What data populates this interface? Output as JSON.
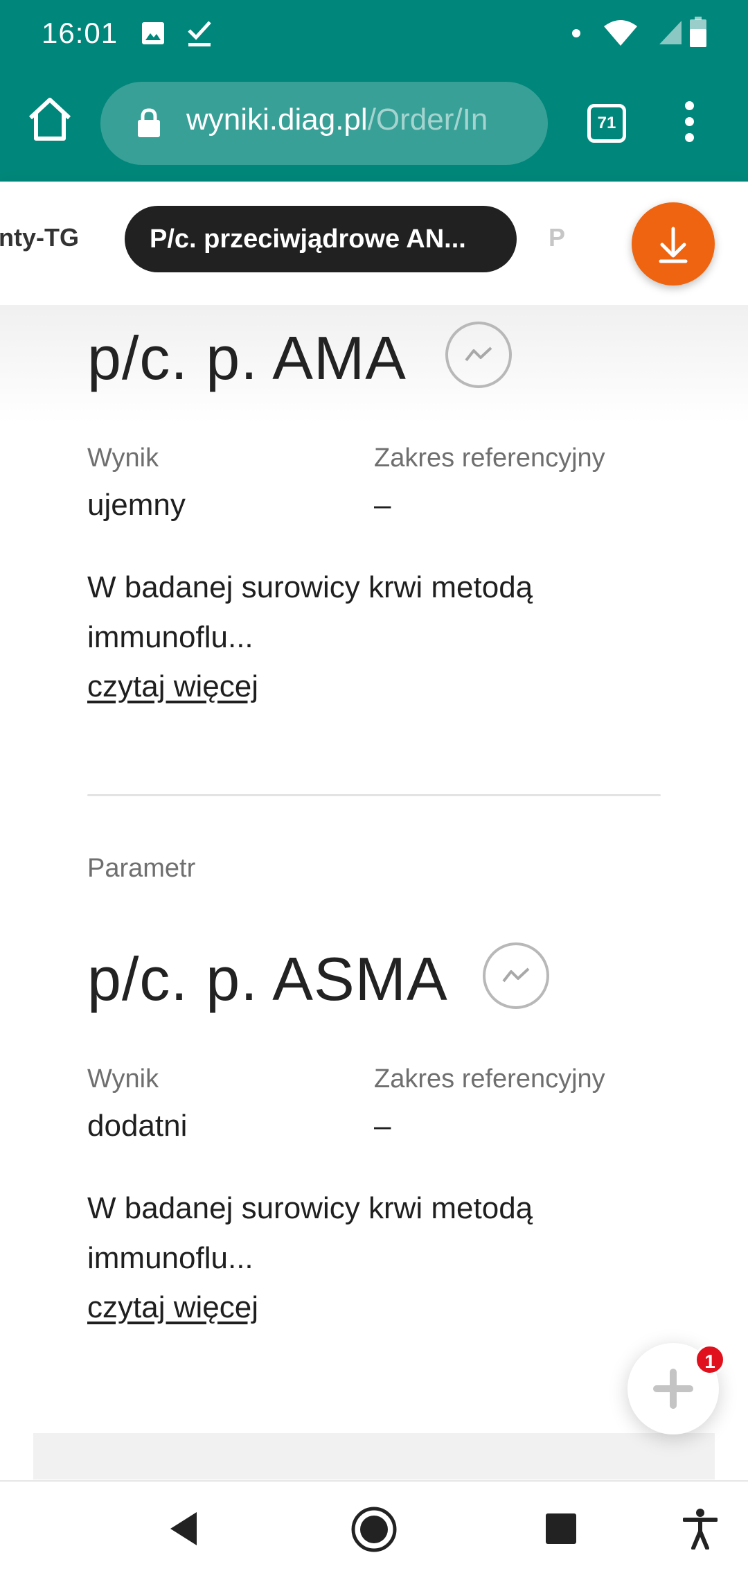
{
  "status_bar": {
    "time": "16:01",
    "icons": [
      "image-icon",
      "check-icon",
      "dot-icon",
      "wifi-icon",
      "signal-icon",
      "battery-icon"
    ]
  },
  "browser": {
    "url_domain": "wyniki.diag.pl",
    "url_path": "/Order/In",
    "tab_count": "71"
  },
  "chips": {
    "left_partial": "nty-TG",
    "active": "P/c. przeciwjądrowe AN...",
    "right_partial": "P"
  },
  "results": [
    {
      "name": "p/c. p. AMA",
      "result_label": "Wynik",
      "result_value": "ujemny",
      "range_label": "Zakres referencyjny",
      "range_value": "–",
      "description": "W badanej surowicy krwi metodą immunoflu...",
      "read_more": "czytaj więcej"
    },
    {
      "section_label": "Parametr",
      "name": "p/c. p. ASMA",
      "result_label": "Wynik",
      "result_value": "dodatni",
      "range_label": "Zakres referencyjny",
      "range_value": "–",
      "description": "W badanej surowicy krwi metodą immunoflu...",
      "read_more": "czytaj więcej"
    }
  ],
  "chat": {
    "badge_count": "1"
  },
  "colors": {
    "toolbar": "#00867a",
    "active_chip": "#212121",
    "download": "#ee6410",
    "badge": "#e0101c"
  }
}
